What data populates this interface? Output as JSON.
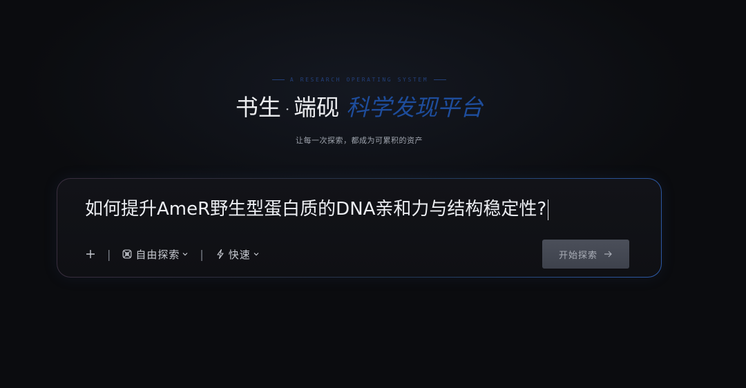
{
  "hero": {
    "tagline": "A RESEARCH OPERATING SYSTEM",
    "title_main_1": "书生",
    "title_dot": "·",
    "title_main_2": "端砚",
    "title_accent": "科学发现平台",
    "subtitle": "让每一次探索，都成为可累积的资产"
  },
  "search": {
    "query": "如何提升AmeR野生型蛋白质的DNA亲和力与结构稳定性?",
    "add_icon": "plus-icon",
    "separator": "|",
    "mode": {
      "icon": "atom-icon",
      "label": "自由探索",
      "dropdown_icon": "chevron-down-icon"
    },
    "speed": {
      "icon": "lightning-icon",
      "label": "快速",
      "dropdown_icon": "chevron-down-icon"
    },
    "submit": {
      "label": "开始探索",
      "icon": "arrow-right-icon"
    }
  },
  "colors": {
    "background": "#0b0c0f",
    "accent": "#1e4d9c",
    "tagline": "#23407a",
    "button": "#464a55"
  }
}
